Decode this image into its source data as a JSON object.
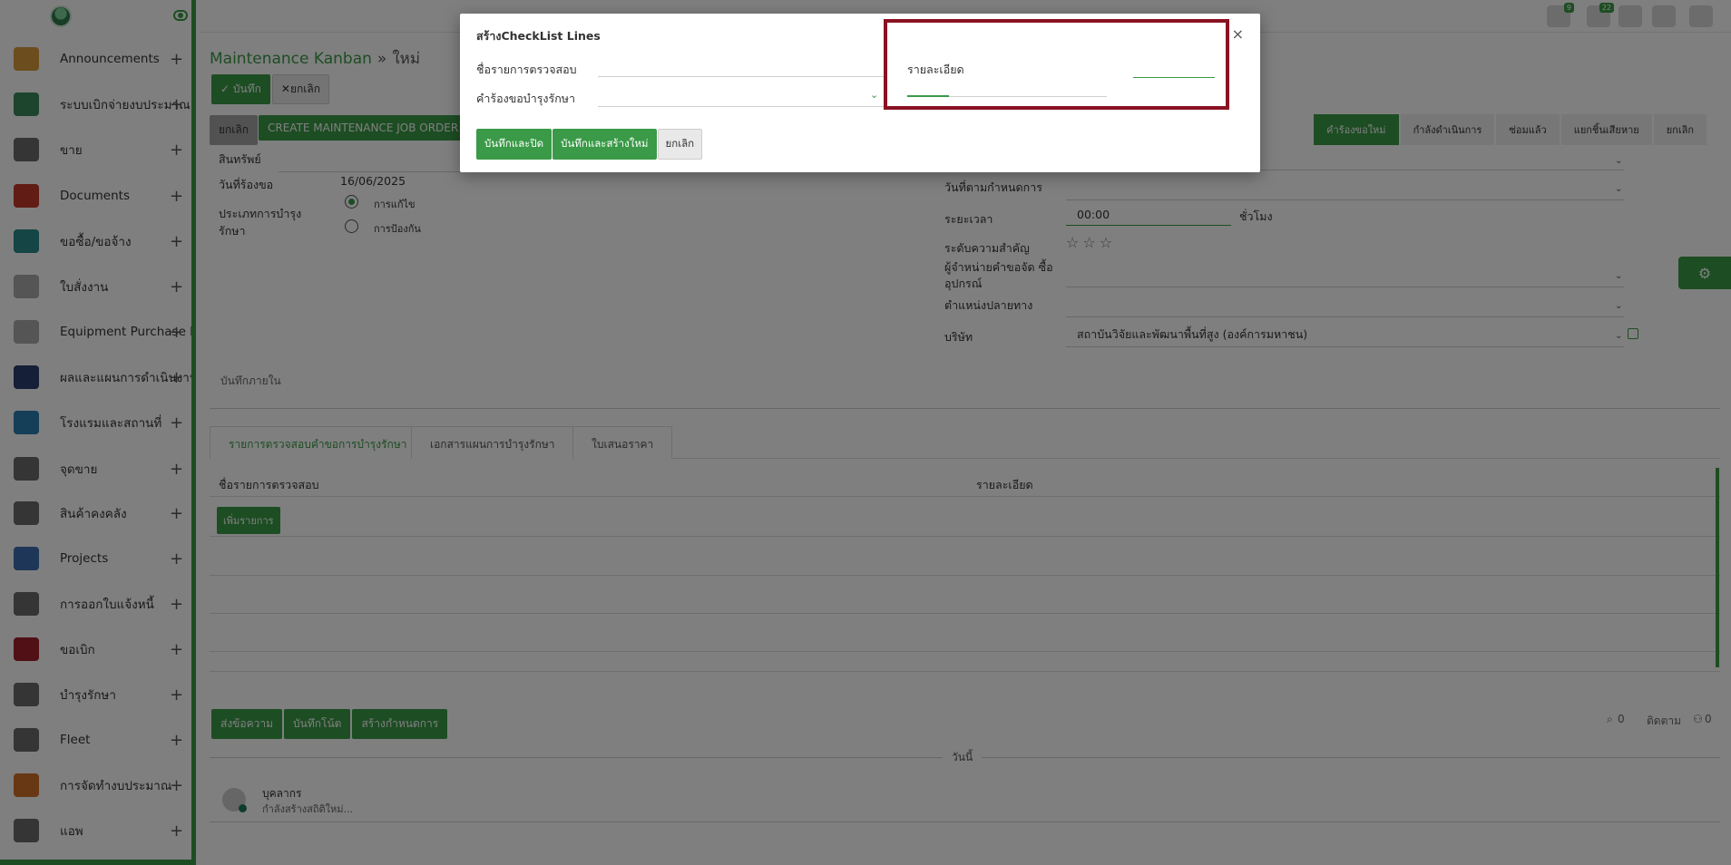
{
  "sidebar": {
    "items": [
      {
        "label": "Announcements",
        "icon": "megaphone-icon",
        "color": "#d89b3c"
      },
      {
        "label": "ระบบเบิกจ่ายงบประมาณ",
        "icon": "budget-check-icon",
        "color": "#3a8a5a"
      },
      {
        "label": "ขาย",
        "icon": "sales-chart-icon",
        "color": "#6a6a6a"
      },
      {
        "label": "Documents",
        "icon": "folder-icon",
        "color": "#c0392b"
      },
      {
        "label": "ขอซื้อ/ขอจ้าง",
        "icon": "cart-icon",
        "color": "#2a8a8a"
      },
      {
        "label": "ใบสั่งงาน",
        "icon": "camera-icon",
        "color": "#aaaaaa"
      },
      {
        "label": "Equipment Purchase Re",
        "icon": "camera-icon",
        "color": "#aaaaaa"
      },
      {
        "label": "ผลและแผนการดำเนินงาน",
        "icon": "bar-chart-icon",
        "color": "#2c3e70"
      },
      {
        "label": "โรงแรมและสถานที่",
        "icon": "hotel-icon",
        "color": "#2a7fb0"
      },
      {
        "label": "จุดขาย",
        "icon": "store-icon",
        "color": "#6a6a6a"
      },
      {
        "label": "สินค้าคงคลัง",
        "icon": "warehouse-icon",
        "color": "#6a6a6a"
      },
      {
        "label": "Projects",
        "icon": "projects-icon",
        "color": "#3d6fb0"
      },
      {
        "label": "การออกใบแจ้งหนี้",
        "icon": "invoice-icon",
        "color": "#6a6a6a"
      },
      {
        "label": "ขอเบิก",
        "icon": "forklift-icon",
        "color": "#a0202a"
      },
      {
        "label": "บำรุงรักษา",
        "icon": "tools-icon",
        "color": "#6a6a6a"
      },
      {
        "label": "Fleet",
        "icon": "truck-icon",
        "color": "#6a6a6a"
      },
      {
        "label": "การจัดทำงบประมาณ",
        "icon": "money-bag-icon",
        "color": "#d0702a"
      },
      {
        "label": "แอพ",
        "icon": "apps-icon",
        "color": "#6a6a6a"
      }
    ]
  },
  "topbar": {
    "badges": [
      "9",
      "22"
    ]
  },
  "main": {
    "breadcrumb": {
      "parent": "Maintenance Kanban",
      "sep": "»",
      "current": "ใหม่"
    },
    "save_label": "บันทึก",
    "discard_label": "ยกเลิก",
    "actions": {
      "cancel": "ยกเลิก",
      "create_job": "CREATE MAINTENANCE JOB ORDER"
    },
    "status_steps": [
      "คำร้องขอใหม่",
      "กำลังดำเนินการ",
      "ซ่อมแล้ว",
      "แยกชิ้นเสียหาย",
      "ยกเลิก"
    ],
    "left_fields": {
      "asset_label": "สินทรัพย์",
      "request_date_label": "วันที่ร้องขอ",
      "request_date_value": "16/06/2025",
      "maint_type_label": "ประเภทการบำรุง รักษา",
      "type_corrective": "การแก้ไข",
      "type_preventive": "การป้องกัน"
    },
    "right_fields": {
      "scheduled_label": "วันที่ตามกำหนดการ",
      "duration_label": "ระยะเวลา",
      "duration_value": "00:00",
      "duration_unit": "ชั่วโมง",
      "priority_label": "ระดับความสำคัญ",
      "vendor_label": "ผู้จำหน่ายคำขอจัด ซื้ออุปกรณ์",
      "location_label": "ตำแหน่งปลายทาง",
      "company_label": "บริษัท",
      "company_value": "สถาบันวิจัยและพัฒนาพื้นที่สูง (องค์การมหาชน)"
    },
    "internal_note_label": "บันทึกภายใน",
    "tabs": [
      "รายการตรวจสอบคำขอการบำรุงรักษา",
      "เอกสารแผนการบำรุงรักษา",
      "ใบเสนอราคา"
    ],
    "grid": {
      "col1": "ชื่อรายการตรวจสอบ",
      "col2": "รายละเอียด",
      "add_line": "เพิ่มรายการ"
    },
    "chatter": {
      "send_message": "ส่งข้อความ",
      "log_note": "บันทึกโน้ต",
      "schedule_activity": "สร้างกำหนดการ",
      "attachments": "0",
      "follow": "ติดตาม",
      "followers": "0",
      "today": "วันนี้",
      "author": "บุคลากร",
      "message": "กำลังสร้างสถิติใหม่..."
    }
  },
  "modal": {
    "title": "สร้างCheckList Lines",
    "close": "×",
    "name_label": "ชื่อรายการตรวจสอบ",
    "request_label": "คำร้องขอบำรุงรักษา",
    "detail_label": "รายละเอียด",
    "save_close": "บันทึกและปิด",
    "save_new": "บันทึกและสร้างใหม่",
    "cancel": "ยกเลิก"
  },
  "colors": {
    "accent": "#3a9a47",
    "highlight": "#8a1222"
  }
}
